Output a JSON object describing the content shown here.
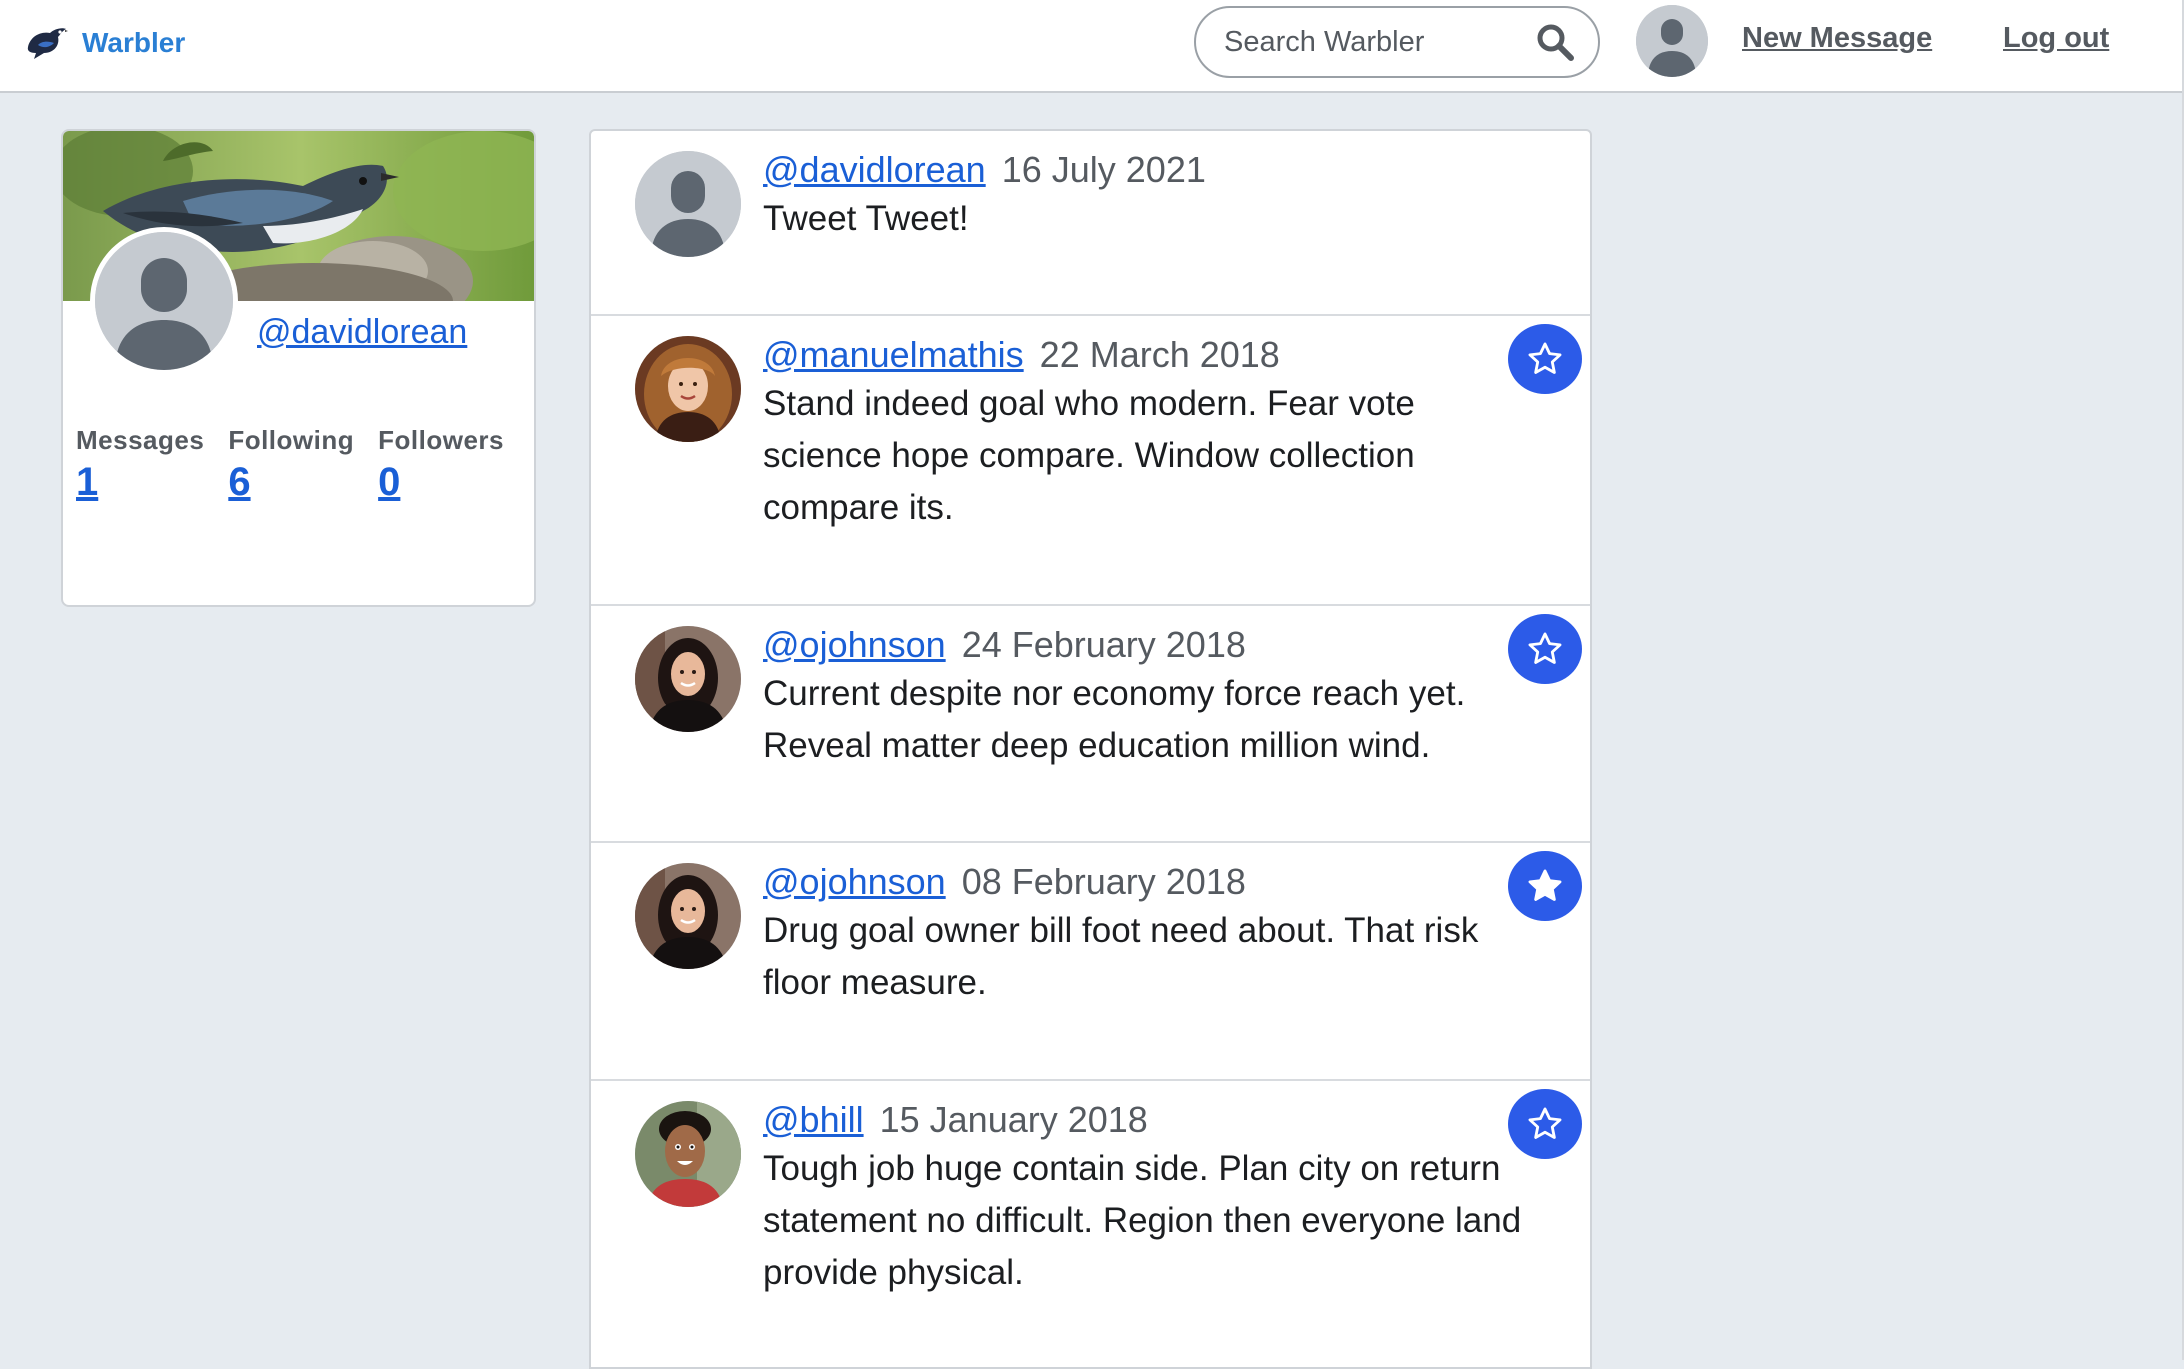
{
  "nav": {
    "brand": "Warbler",
    "search_placeholder": "Search Warbler",
    "new_message": "New Message",
    "logout": "Log out"
  },
  "profile": {
    "username": "@davidlorean",
    "stats": [
      {
        "label": "Messages",
        "value": "1"
      },
      {
        "label": "Following",
        "value": "6"
      },
      {
        "label": "Followers",
        "value": "0"
      }
    ]
  },
  "messages": [
    {
      "user": "@davidlorean",
      "date": "16 July 2021",
      "text": "Tweet Tweet!",
      "liked": null
    },
    {
      "user": "@manuelmathis",
      "date": "22 March 2018",
      "text": "Stand indeed goal who modern. Fear vote science hope compare. Window collection compare its.",
      "liked": false
    },
    {
      "user": "@ojohnson",
      "date": "24 February 2018",
      "text": "Current despite nor economy force reach yet. Reveal matter deep education million wind.",
      "liked": false
    },
    {
      "user": "@ojohnson",
      "date": "08 February 2018",
      "text": "Drug goal owner bill foot need about. That risk floor measure.",
      "liked": true
    },
    {
      "user": "@bhill",
      "date": "15 January 2018",
      "text": "Tough job huge contain side. Plan city on return statement no difficult. Region then everyone land provide physical.",
      "liked": false
    }
  ],
  "colors": {
    "accent": "#1a5fd6",
    "brand": "#2a7fd4",
    "like_button": "#2c5be8",
    "background": "#e6ebf0"
  }
}
